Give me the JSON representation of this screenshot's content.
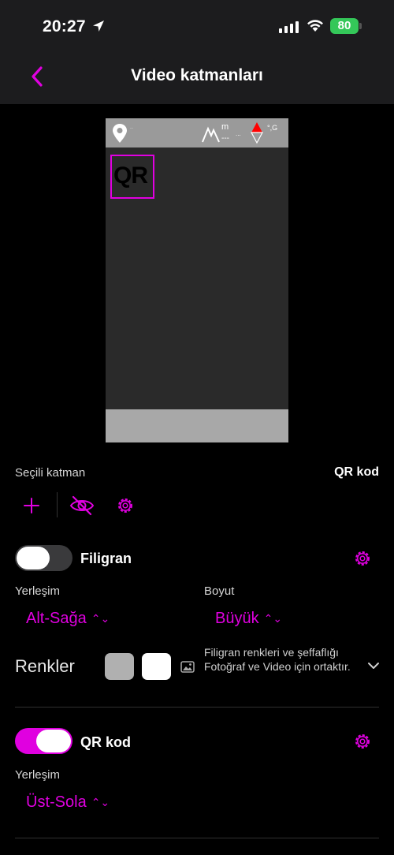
{
  "status": {
    "time": "20:27",
    "battery": "80"
  },
  "nav": {
    "title": "Video katmanları"
  },
  "preview": {
    "pin_text": "---",
    "alt_unit": "m",
    "alt_value": "---",
    "ellipsis": "...",
    "compass_text": "°,G",
    "qr_label": "QR"
  },
  "selected_layer": {
    "label": "Seçili katman",
    "value": "QR kod"
  },
  "watermark": {
    "title": "Filigran",
    "enabled": false,
    "placement_label": "Yerleşim",
    "placement_value": "Alt-Sağa",
    "size_label": "Boyut",
    "size_value": "Büyük",
    "colors_label": "Renkler",
    "colors": [
      "#b0b0b0",
      "#ffffff"
    ],
    "note": "Filigran renkleri ve şeffaflığı Fotoğraf ve Video için ortaktır."
  },
  "qr": {
    "title": "QR kod",
    "enabled": true,
    "placement_label": "Yerleşim",
    "placement_value": "Üst-Sola"
  },
  "icons": {
    "back": "chevron-left-icon",
    "add": "plus-icon",
    "visibility": "eye-slash-icon",
    "settings": "gear-icon",
    "photo": "photo-icon",
    "expand": "chevron-down-icon"
  },
  "colors": {
    "accent": "#e000e0",
    "battery": "#34c759",
    "bar_bg": "#1c1c1e"
  }
}
